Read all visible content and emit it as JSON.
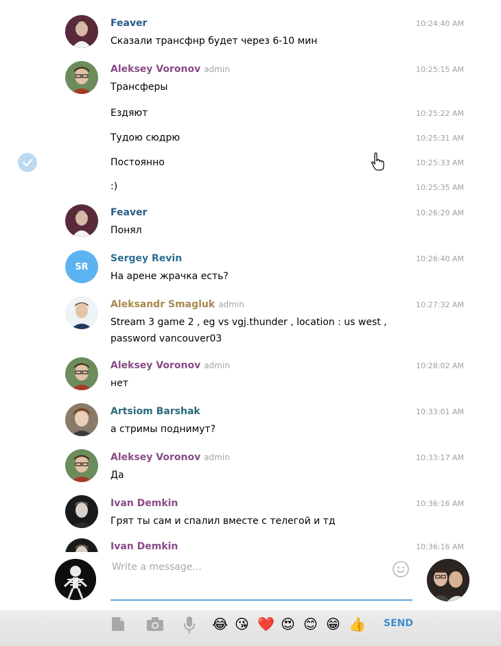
{
  "messages": [
    {
      "author": "Feaver",
      "author_color": "#2a5b88",
      "admin": "",
      "time": "10:24:40 AM",
      "text": "Сказали трансфнр будет через 6-10 мин"
    },
    {
      "author": "Aleksey Voronov",
      "author_color": "#874b87",
      "admin": "admin",
      "time": "10:25:15 AM",
      "text": "Трансферы"
    },
    {
      "time": "10:25:22 AM",
      "text": "Ездяют"
    },
    {
      "time": "10:25:31 AM",
      "text": "Тудою сюдрю"
    },
    {
      "time": "10:25:33 AM",
      "text": "Постоянно"
    },
    {
      "time": "10:25:35 AM",
      "text": ":)"
    },
    {
      "author": "Feaver",
      "author_color": "#2a5b88",
      "admin": "",
      "time": "10:26:20 AM",
      "text": "Понял"
    },
    {
      "author": "Sergey Revin",
      "author_color": "#2a6f93",
      "admin": "",
      "time": "10:26:40 AM",
      "text": "На арене жрачка есть?",
      "initials": "SR",
      "avatar_color": "#5cb3f2"
    },
    {
      "author": "Aleksandr Smagluk",
      "author_color": "#a5894a",
      "admin": "admin",
      "time": "10:27:32 AM",
      "text": "Stream 3 game 2 , eg vs vgj.thunder , location : us west ,\npassword vancouver03"
    },
    {
      "author": "Aleksey Voronov",
      "author_color": "#874b87",
      "admin": "admin",
      "time": "10:28:02 AM",
      "text": "нет"
    },
    {
      "author": "Artsiom Barshak",
      "author_color": "#2a6b7a",
      "admin": "",
      "time": "10:33:01 AM",
      "text": "а стримы поднимут?"
    },
    {
      "author": "Aleksey Voronov",
      "author_color": "#874b87",
      "admin": "admin",
      "time": "10:33:17 AM",
      "text": "Да"
    },
    {
      "author": "Ivan Demkin",
      "author_color": "#874b87",
      "admin": "",
      "time": "10:36:16 AM",
      "text": "Грят ты сам и спалил вместе с телегой и тд"
    },
    {
      "author": "Ivan Demkin",
      "author_color": "#874b87",
      "admin": "",
      "time": "10:36:16 AM",
      "text": ""
    }
  ],
  "composer": {
    "placeholder": "Write a message..."
  },
  "toolbar": {
    "send_label": "SEND",
    "icons": [
      "file-icon",
      "camera-icon",
      "microphone-icon",
      "emoji-smile-icon"
    ],
    "emojis": [
      "😂",
      "😘",
      "❤️",
      "😍",
      "😊",
      "😁",
      "👍"
    ]
  },
  "colors": {
    "accent": "#3f8ccf",
    "timestamp": "#a0a0a0",
    "check": "#bcd9f0"
  }
}
